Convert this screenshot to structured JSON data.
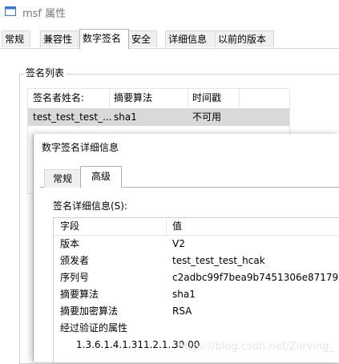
{
  "window": {
    "title": "msf 属性"
  },
  "tabs": [
    "常规",
    "兼容性",
    "数字签名",
    "安全",
    "详细信息",
    "以前的版本"
  ],
  "active_tab": "数字签名",
  "signature_list": {
    "group_label": "签名列表",
    "columns": [
      "签名者姓名:",
      "摘要算法",
      "时间戳"
    ],
    "rows": [
      {
        "signer": "test_test_test_...",
        "digest": "sha1",
        "timestamp": "不可用"
      }
    ]
  },
  "dialog": {
    "title": "数字签名详细信息",
    "tabs": [
      "常规",
      "高级"
    ],
    "active_tab": "高级",
    "details_label": "签名详细信息(S):",
    "columns": [
      "字段",
      "值"
    ],
    "rows": [
      {
        "field": "版本",
        "value": "V2"
      },
      {
        "field": "颁发者",
        "value": "test_test_test_hcak"
      },
      {
        "field": "序列号",
        "value": "c2adbc99f7bea9b7451306e87179..."
      },
      {
        "field": "摘要算法",
        "value": "sha1"
      },
      {
        "field": "摘要加密算法",
        "value": "RSA"
      },
      {
        "field": "经过验证的属性",
        "value": ""
      },
      {
        "field": "1.3.6.1.4.1.311.2.1...",
        "value": "30 00"
      }
    ]
  },
  "watermark": "https://blog.csdn.net/Zlirving_"
}
